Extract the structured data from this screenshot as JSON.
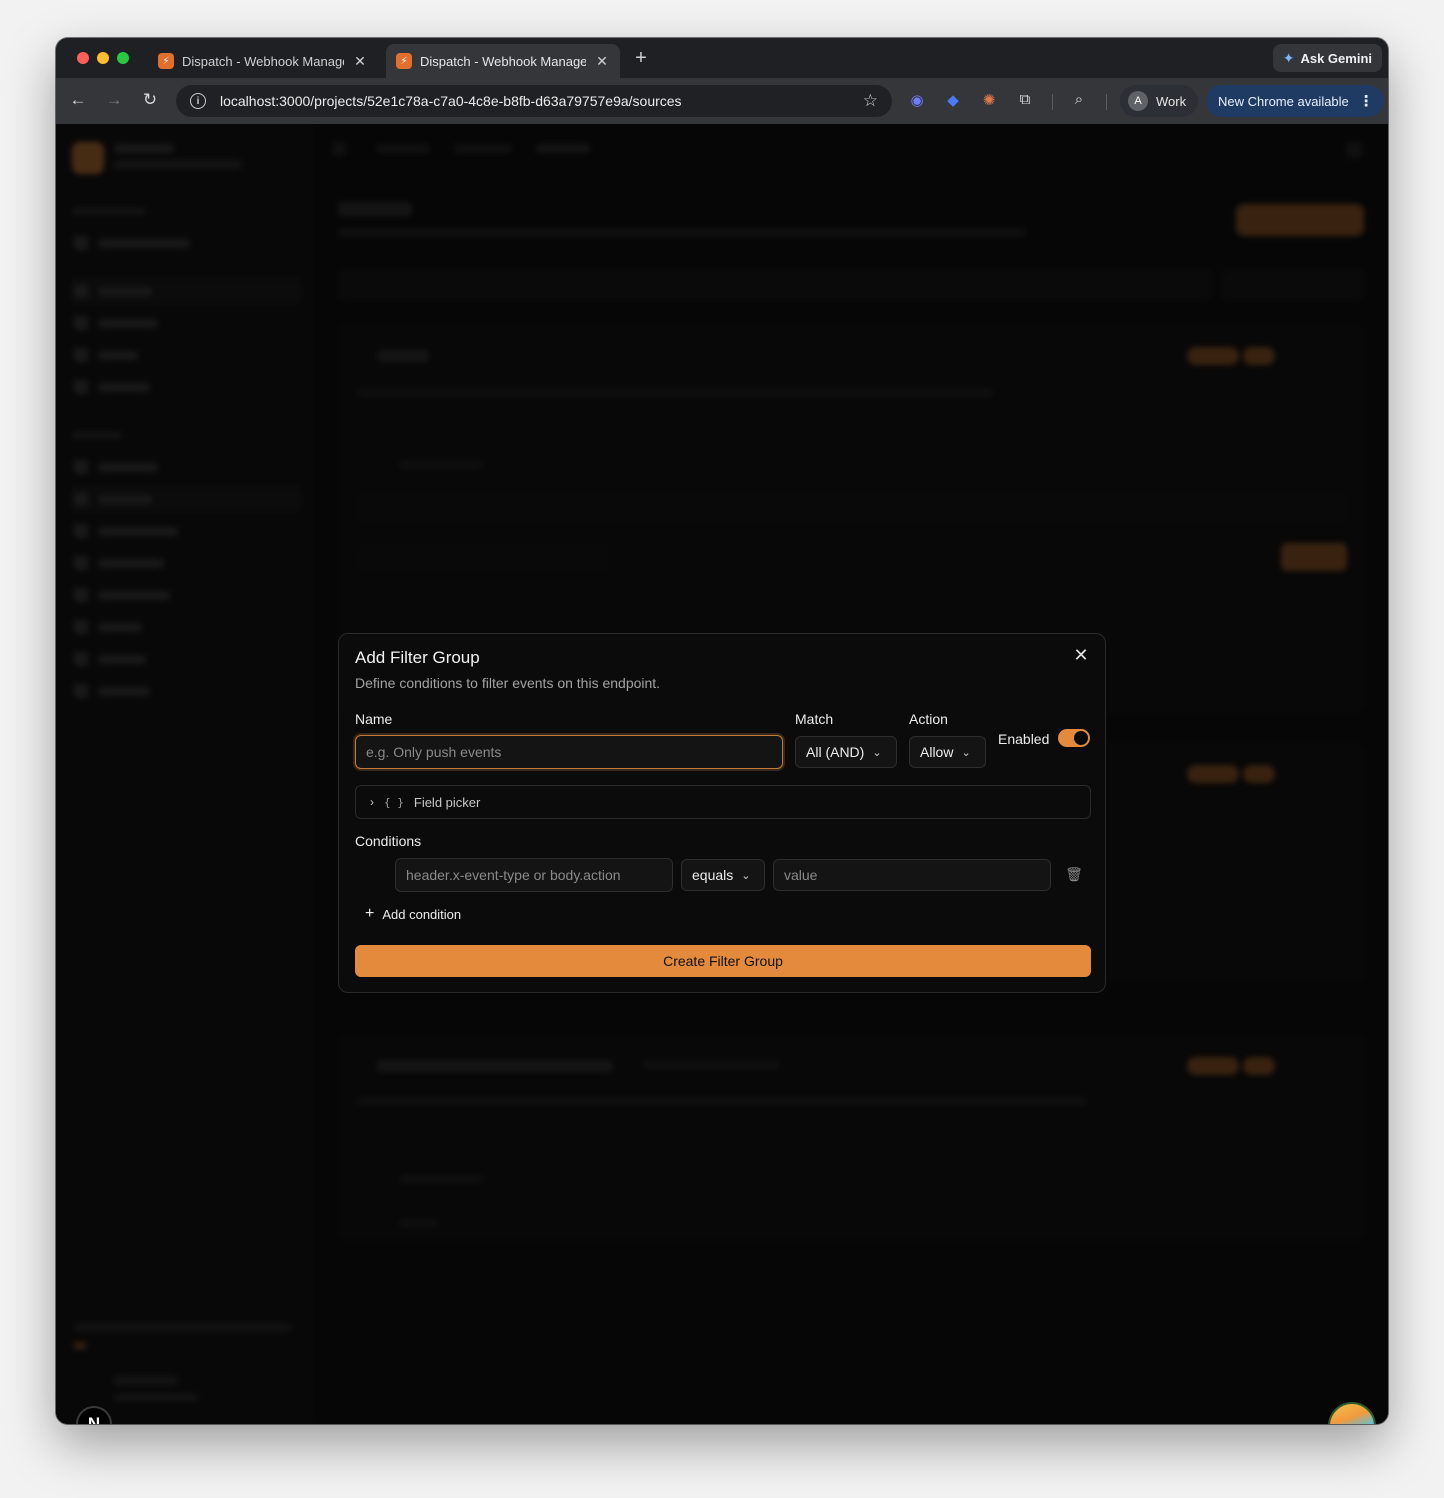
{
  "browser": {
    "tabs": [
      {
        "title": "Dispatch - Webhook Manager",
        "active": false
      },
      {
        "title": "Dispatch - Webhook Manager",
        "active": true
      }
    ],
    "new_tab_icon": "+",
    "ask_gemini": "Ask Gemini",
    "url": "localhost:3000/projects/52e1c78a-c7a0-4c8e-b8fb-d63a79757e9a/sources",
    "profile_initial": "A",
    "profile_name": "Work",
    "update_text": "New Chrome available"
  },
  "modal": {
    "title": "Add Filter Group",
    "description": "Define conditions to filter events on this endpoint.",
    "name_label": "Name",
    "name_placeholder": "e.g. Only push events",
    "match_label": "Match",
    "match_value": "All (AND)",
    "action_label": "Action",
    "action_value": "Allow",
    "enabled_label": "Enabled",
    "enabled": true,
    "field_picker_label": "Field picker",
    "conditions_label": "Conditions",
    "condition": {
      "field_placeholder": "header.x-event-type or body.action",
      "operator": "equals",
      "value_placeholder": "value"
    },
    "add_condition_label": "Add condition",
    "submit_label": "Create Filter Group"
  },
  "colors": {
    "accent": "#e48a3c",
    "background": "#0c0c0c"
  },
  "next_badge": "N"
}
